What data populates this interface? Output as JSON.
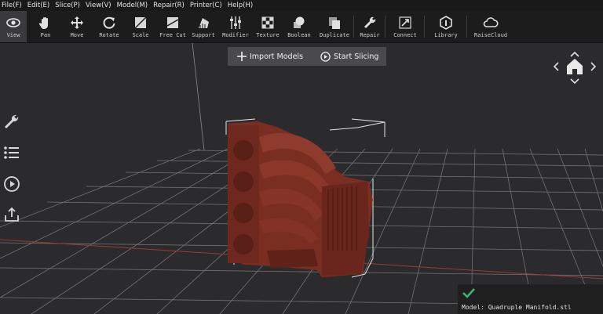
{
  "menu": [
    {
      "label": "File(F)"
    },
    {
      "label": "Edit(E)"
    },
    {
      "label": "Slice(P)"
    },
    {
      "label": "View(V)"
    },
    {
      "label": "Model(M)"
    },
    {
      "label": "Repair(R)"
    },
    {
      "label": "Printer(C)"
    },
    {
      "label": "Help(H)"
    }
  ],
  "toolbar": [
    {
      "label": "View",
      "icon": "eye-icon"
    },
    {
      "label": "Pan",
      "icon": "hand-icon"
    },
    {
      "label": "Move",
      "icon": "move-arrows-icon"
    },
    {
      "label": "Rotate",
      "icon": "rotate-icon"
    },
    {
      "label": "Scale",
      "icon": "scale-icon"
    },
    {
      "label": "Free Cut",
      "icon": "free-cut-icon"
    },
    {
      "label": "Support",
      "icon": "support-icon"
    },
    {
      "label": "Modifier",
      "icon": "sliders-icon"
    },
    {
      "label": "Texture",
      "icon": "checker-icon"
    },
    {
      "label": "Boolean",
      "icon": "boolean-icon"
    },
    {
      "label": "Duplicate",
      "icon": "duplicate-icon"
    },
    {
      "label": "Repair",
      "icon": "wrench-icon"
    },
    {
      "label": "Connect",
      "icon": "connect-icon"
    },
    {
      "label": "Library",
      "icon": "library-icon"
    },
    {
      "label": "RaiseCloud",
      "icon": "cloud-icon"
    }
  ],
  "actions": {
    "import": "Import Models",
    "slice": "Start Slicing"
  },
  "status": {
    "model": "Model: Quadruple Manifold.stl"
  },
  "colors": {
    "model": "#7a2e22",
    "background": "#2b2b2d",
    "toolbar": "#1c1c1d",
    "check": "#3cb371"
  }
}
